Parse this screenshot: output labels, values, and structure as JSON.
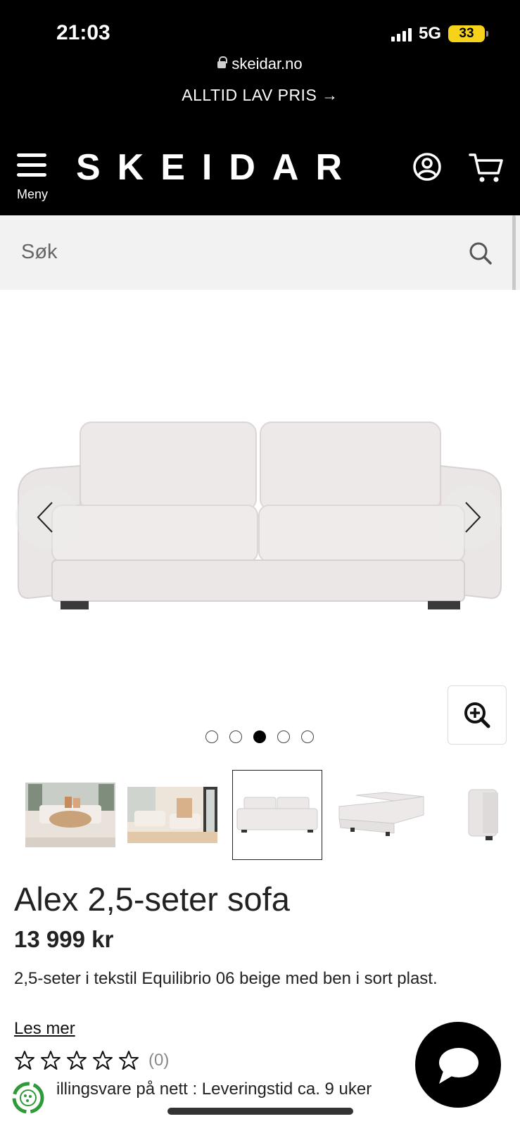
{
  "status_bar": {
    "time": "21:03",
    "network": "5G",
    "battery": "33"
  },
  "browser": {
    "url": "skeidar.no"
  },
  "promo": {
    "text": "ALLTID LAV PRIS →"
  },
  "header": {
    "menu_label": "Meny",
    "logo": "SKEIDAR"
  },
  "search": {
    "placeholder": "Søk"
  },
  "gallery": {
    "active_index": 2,
    "dot_count": 5,
    "thumbnail_count": 5,
    "selected_thumbnail": 2
  },
  "product": {
    "title": "Alex 2,5-seter sofa",
    "price": "13 999 kr",
    "description": "2,5-seter i tekstil Equilibrio 06 beige med ben i sort plast.",
    "read_more": "Les mer",
    "rating_stars": 5,
    "review_count": "(0)",
    "delivery": "illingsvare på nett : Leveringstid ca. 9 uker"
  },
  "colors": {
    "header_bg": "#000000",
    "search_bg": "#f2f2f2",
    "sofa_fabric": "#ece7e7",
    "battery": "#f6d31a"
  }
}
